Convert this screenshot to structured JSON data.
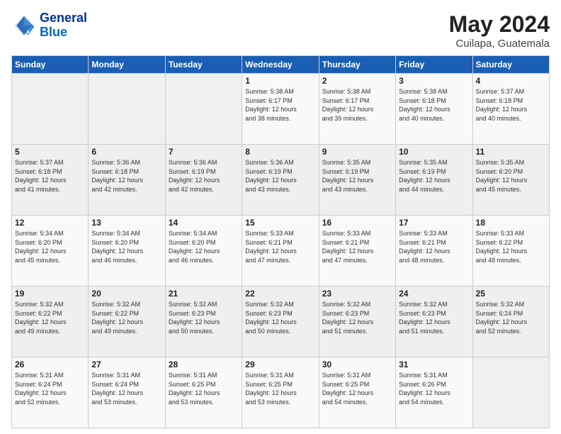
{
  "header": {
    "logo_line1": "General",
    "logo_line2": "Blue",
    "month_year": "May 2024",
    "location": "Cuilapa, Guatemala"
  },
  "days_of_week": [
    "Sunday",
    "Monday",
    "Tuesday",
    "Wednesday",
    "Thursday",
    "Friday",
    "Saturday"
  ],
  "weeks": [
    [
      {
        "day": "",
        "info": ""
      },
      {
        "day": "",
        "info": ""
      },
      {
        "day": "",
        "info": ""
      },
      {
        "day": "1",
        "info": "Sunrise: 5:38 AM\nSunset: 6:17 PM\nDaylight: 12 hours\nand 38 minutes."
      },
      {
        "day": "2",
        "info": "Sunrise: 5:38 AM\nSunset: 6:17 PM\nDaylight: 12 hours\nand 39 minutes."
      },
      {
        "day": "3",
        "info": "Sunrise: 5:38 AM\nSunset: 6:18 PM\nDaylight: 12 hours\nand 40 minutes."
      },
      {
        "day": "4",
        "info": "Sunrise: 5:37 AM\nSunset: 6:18 PM\nDaylight: 12 hours\nand 40 minutes."
      }
    ],
    [
      {
        "day": "5",
        "info": "Sunrise: 5:37 AM\nSunset: 6:18 PM\nDaylight: 12 hours\nand 41 minutes."
      },
      {
        "day": "6",
        "info": "Sunrise: 5:36 AM\nSunset: 6:18 PM\nDaylight: 12 hours\nand 42 minutes."
      },
      {
        "day": "7",
        "info": "Sunrise: 5:36 AM\nSunset: 6:19 PM\nDaylight: 12 hours\nand 42 minutes."
      },
      {
        "day": "8",
        "info": "Sunrise: 5:36 AM\nSunset: 6:19 PM\nDaylight: 12 hours\nand 43 minutes."
      },
      {
        "day": "9",
        "info": "Sunrise: 5:35 AM\nSunset: 6:19 PM\nDaylight: 12 hours\nand 43 minutes."
      },
      {
        "day": "10",
        "info": "Sunrise: 5:35 AM\nSunset: 6:19 PM\nDaylight: 12 hours\nand 44 minutes."
      },
      {
        "day": "11",
        "info": "Sunrise: 5:35 AM\nSunset: 6:20 PM\nDaylight: 12 hours\nand 45 minutes."
      }
    ],
    [
      {
        "day": "12",
        "info": "Sunrise: 5:34 AM\nSunset: 6:20 PM\nDaylight: 12 hours\nand 45 minutes."
      },
      {
        "day": "13",
        "info": "Sunrise: 5:34 AM\nSunset: 6:20 PM\nDaylight: 12 hours\nand 46 minutes."
      },
      {
        "day": "14",
        "info": "Sunrise: 5:34 AM\nSunset: 6:20 PM\nDaylight: 12 hours\nand 46 minutes."
      },
      {
        "day": "15",
        "info": "Sunrise: 5:33 AM\nSunset: 6:21 PM\nDaylight: 12 hours\nand 47 minutes."
      },
      {
        "day": "16",
        "info": "Sunrise: 5:33 AM\nSunset: 6:21 PM\nDaylight: 12 hours\nand 47 minutes."
      },
      {
        "day": "17",
        "info": "Sunrise: 5:33 AM\nSunset: 6:21 PM\nDaylight: 12 hours\nand 48 minutes."
      },
      {
        "day": "18",
        "info": "Sunrise: 5:33 AM\nSunset: 6:22 PM\nDaylight: 12 hours\nand 48 minutes."
      }
    ],
    [
      {
        "day": "19",
        "info": "Sunrise: 5:32 AM\nSunset: 6:22 PM\nDaylight: 12 hours\nand 49 minutes."
      },
      {
        "day": "20",
        "info": "Sunrise: 5:32 AM\nSunset: 6:22 PM\nDaylight: 12 hours\nand 49 minutes."
      },
      {
        "day": "21",
        "info": "Sunrise: 5:32 AM\nSunset: 6:23 PM\nDaylight: 12 hours\nand 50 minutes."
      },
      {
        "day": "22",
        "info": "Sunrise: 5:32 AM\nSunset: 6:23 PM\nDaylight: 12 hours\nand 50 minutes."
      },
      {
        "day": "23",
        "info": "Sunrise: 5:32 AM\nSunset: 6:23 PM\nDaylight: 12 hours\nand 51 minutes."
      },
      {
        "day": "24",
        "info": "Sunrise: 5:32 AM\nSunset: 6:23 PM\nDaylight: 12 hours\nand 51 minutes."
      },
      {
        "day": "25",
        "info": "Sunrise: 5:32 AM\nSunset: 6:24 PM\nDaylight: 12 hours\nand 52 minutes."
      }
    ],
    [
      {
        "day": "26",
        "info": "Sunrise: 5:31 AM\nSunset: 6:24 PM\nDaylight: 12 hours\nand 52 minutes."
      },
      {
        "day": "27",
        "info": "Sunrise: 5:31 AM\nSunset: 6:24 PM\nDaylight: 12 hours\nand 53 minutes."
      },
      {
        "day": "28",
        "info": "Sunrise: 5:31 AM\nSunset: 6:25 PM\nDaylight: 12 hours\nand 53 minutes."
      },
      {
        "day": "29",
        "info": "Sunrise: 5:31 AM\nSunset: 6:25 PM\nDaylight: 12 hours\nand 53 minutes."
      },
      {
        "day": "30",
        "info": "Sunrise: 5:31 AM\nSunset: 6:25 PM\nDaylight: 12 hours\nand 54 minutes."
      },
      {
        "day": "31",
        "info": "Sunrise: 5:31 AM\nSunset: 6:26 PM\nDaylight: 12 hours\nand 54 minutes."
      },
      {
        "day": "",
        "info": ""
      }
    ]
  ]
}
